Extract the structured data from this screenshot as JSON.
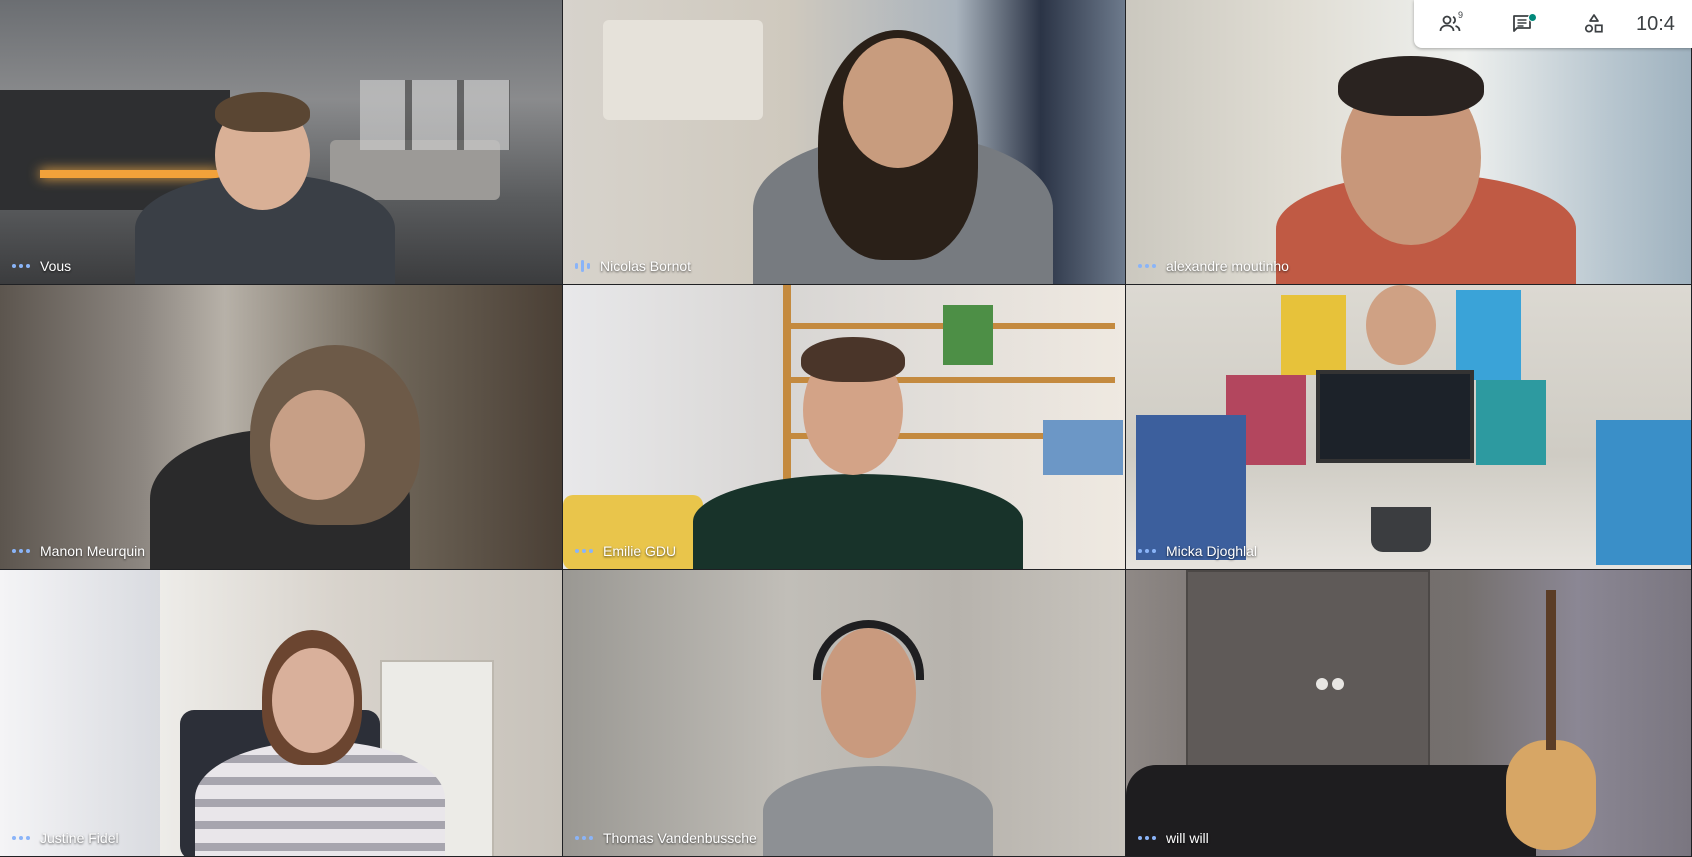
{
  "participants": [
    {
      "name": "Vous",
      "speaking": false
    },
    {
      "name": "Nicolas Bornot",
      "speaking": true
    },
    {
      "name": "alexandre moutinho",
      "speaking": false
    },
    {
      "name": "Manon Meurquin",
      "speaking": false
    },
    {
      "name": "Emilie GDU",
      "speaking": false
    },
    {
      "name": "Micka Djoghlal",
      "speaking": false
    },
    {
      "name": "Justine Fidel",
      "speaking": false
    },
    {
      "name": "Thomas Vandenbussche",
      "speaking": false
    },
    {
      "name": "will will",
      "speaking": false
    }
  ],
  "toolbar": {
    "participants_count": "9",
    "chat_has_unread": true,
    "clock": "10:4"
  },
  "icons": {
    "people": "people-icon",
    "chat": "chat-icon",
    "activities": "activities-icon"
  },
  "colors": {
    "speaking_indicator": "#8ab4f8",
    "chat_dot": "#00897b"
  }
}
